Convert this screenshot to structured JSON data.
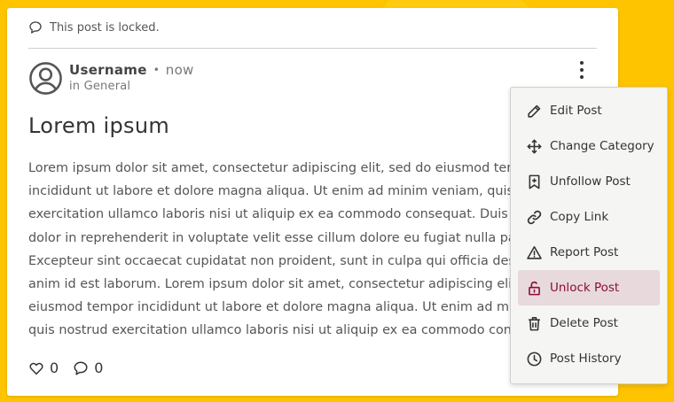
{
  "post": {
    "locked_notice": "This post is locked.",
    "username": "Username",
    "separator": "•",
    "time": "now",
    "category_line": "in General",
    "title": "Lorem ipsum",
    "body_lines": [
      "Lorem ipsum dolor sit amet, consectetur adipiscing elit, sed do eiusmod tem",
      "incididunt ut labore et dolore magna aliqua. Ut enim ad minim veniam, quis",
      "exercitation ullamco laboris nisi ut aliquip ex ea commodo consequat. Duis a",
      "dolor in reprehenderit in voluptate velit esse cillum dolore eu fugiat nulla par",
      "Excepteur sint occaecat cupidatat non proident, sunt in culpa qui officia des",
      "anim id est laborum. Lorem ipsum dolor sit amet, consectetur adipiscing elit",
      "eiusmod tempor incididunt ut labore et dolore magna aliqua. Ut enim ad min",
      "quis nostrud exercitation ullamco laboris nisi ut aliquip ex ea commodo cons"
    ],
    "like_count": "0",
    "comment_count": "0"
  },
  "menu": {
    "items": [
      {
        "label": "Edit Post",
        "icon": "pencil-icon"
      },
      {
        "label": "Change Category",
        "icon": "move-arrows-icon"
      },
      {
        "label": "Unfollow Post",
        "icon": "bookmark-icon"
      },
      {
        "label": "Copy Link",
        "icon": "link-icon"
      },
      {
        "label": "Report Post",
        "icon": "warning-icon"
      },
      {
        "label": "Unlock Post",
        "icon": "unlock-icon",
        "active": true
      },
      {
        "label": "Delete Post",
        "icon": "trash-icon"
      },
      {
        "label": "Post History",
        "icon": "clock-icon"
      }
    ]
  },
  "colors": {
    "background": "#ffc400",
    "active_item_bg": "#e8d9dd",
    "active_item_text": "#8b0d3a"
  }
}
